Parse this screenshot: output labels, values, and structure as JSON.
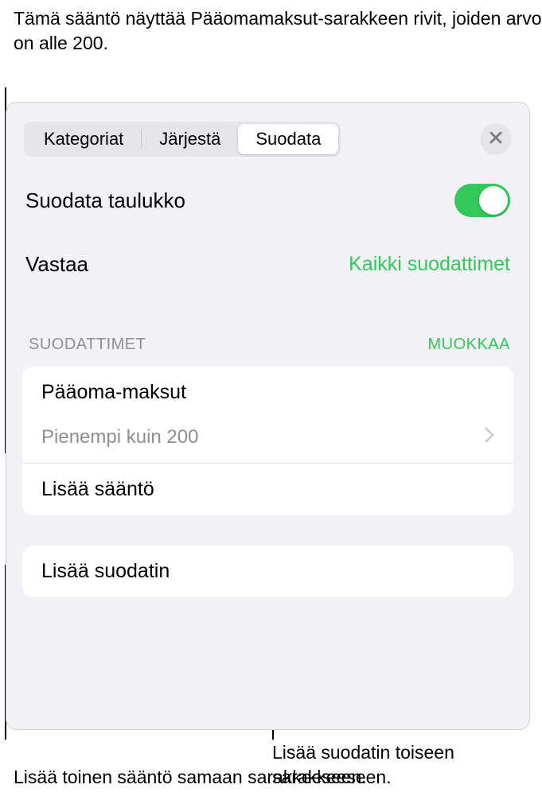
{
  "callouts": {
    "top": "Tämä sääntö näyttää Pääomamaksut-sarakkeen rivit, joiden arvo on alle 200.",
    "bottom_left": "Lisää toinen sääntö samaan sarakkeeseen.",
    "bottom_right": "Lisää suodatin toiseen sarakkeeseen."
  },
  "tabs": {
    "categories": "Kategoriat",
    "sort": "Järjestä",
    "filter": "Suodata"
  },
  "filter_table_label": "Suodata taulukko",
  "match": {
    "label": "Vastaa",
    "value": "Kaikki suodattimet"
  },
  "section": {
    "title": "SUODATTIMET",
    "edit": "MUOKKAA"
  },
  "filter_rule": {
    "column": "Pääoma-maksut",
    "condition": "Pienempi kuin 200",
    "add_rule": "Lisää sääntö"
  },
  "add_filter": "Lisää suodatin"
}
